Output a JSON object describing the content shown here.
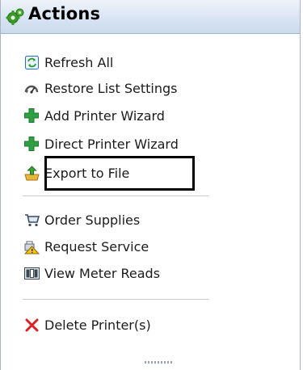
{
  "panel": {
    "title": "Actions",
    "title_icon": "gears-icon"
  },
  "groups": [
    {
      "items": [
        {
          "label": "Refresh All",
          "icon": "refresh-icon"
        },
        {
          "label": "Restore List Settings",
          "icon": "restore-icon"
        },
        {
          "label": "Add Printer Wizard",
          "icon": "green-plus-icon"
        },
        {
          "label": "Direct Printer Wizard",
          "icon": "green-plus-icon"
        },
        {
          "label": "Export to File",
          "icon": "export-icon",
          "highlighted": true
        }
      ]
    },
    {
      "items": [
        {
          "label": "Order Supplies",
          "icon": "cart-icon"
        },
        {
          "label": "Request Service",
          "icon": "service-icon"
        },
        {
          "label": "View Meter Reads",
          "icon": "meter-icon"
        }
      ]
    },
    {
      "items": [
        {
          "label": "Delete Printer(s)",
          "icon": "red-x-icon"
        }
      ]
    }
  ],
  "colors": {
    "header_gradient_top": "#eef3fa",
    "header_gradient_bottom": "#cbdaee",
    "plus_green": "#2ea043",
    "delete_red": "#e02020"
  }
}
